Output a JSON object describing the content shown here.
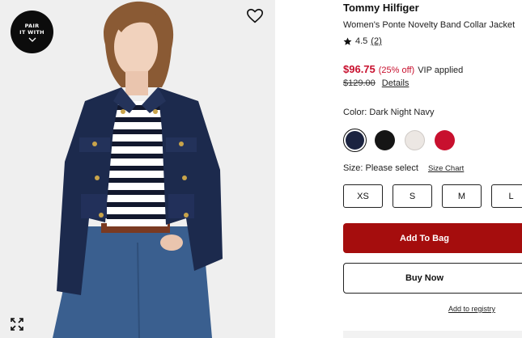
{
  "image": {
    "pair_badge": {
      "line1": "PAIR",
      "line2": "IT WITH"
    },
    "icons": {
      "wishlist": "heart-outline-icon",
      "expand": "expand-arrows-icon",
      "pair_chevron": "chevron-down-icon"
    }
  },
  "product": {
    "brand": "Tommy Hilfiger",
    "name": "Women's Ponte Novelty Band Collar Jacket",
    "rating": {
      "value": "4.5",
      "count": "(2)",
      "icon": "star-icon"
    },
    "price": {
      "sale": "$96.75",
      "discount": "(25% off)",
      "vip": "VIP applied",
      "original": "$129.00",
      "details_link": "Details"
    }
  },
  "color": {
    "label": "Color: Dark Night Navy",
    "swatches": [
      {
        "name": "Dark Night Navy",
        "hex": "#1b2340",
        "selected": true
      },
      {
        "name": "Black",
        "hex": "#151515",
        "selected": false
      },
      {
        "name": "Ivory",
        "hex": "#ece7e3",
        "selected": false
      },
      {
        "name": "Red",
        "hex": "#c8102e",
        "selected": false
      }
    ]
  },
  "size": {
    "label": "Size: Please select",
    "chart_link": "Size Chart",
    "options": [
      "XS",
      "S",
      "M",
      "L"
    ]
  },
  "actions": {
    "add_to_bag": "Add To Bag",
    "buy_now": "Buy Now",
    "registry": "Add to registry"
  },
  "colors": {
    "sale_red": "#c8102e",
    "add_bag_bg": "#a50d0d",
    "jacket_navy": "#1c2a4d"
  }
}
